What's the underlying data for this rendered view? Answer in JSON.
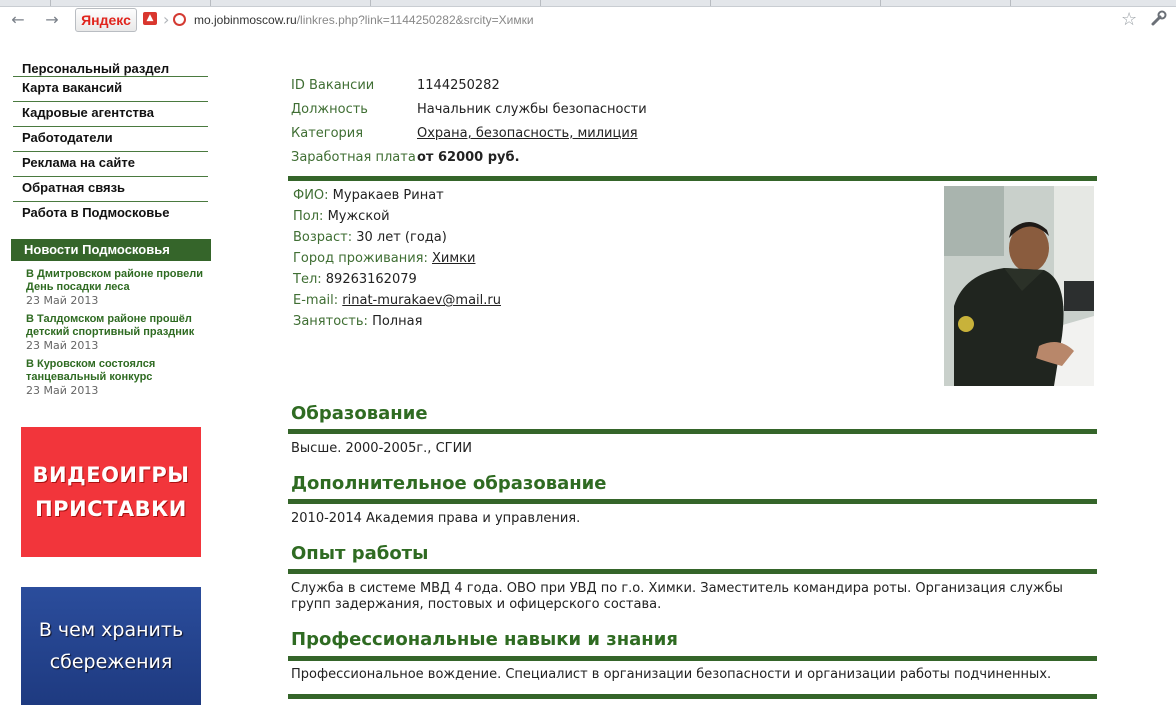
{
  "browser": {
    "search_label": "Яндекс",
    "url_host": "mo.jobinmoscow.ru",
    "url_path": "/linkres.php?link=1144250282&srcity=Химки"
  },
  "nav": {
    "items": [
      "Персональный раздел",
      "Карта вакансий",
      "Кадровые агентства",
      "Работодатели",
      "Реклама на сайте",
      "Обратная связь",
      "Работа в Подмосковье"
    ]
  },
  "news": {
    "heading": "Новости Подмосковья",
    "items": [
      {
        "title": "В Дмитровском районе провели День посадки леса",
        "date": "23 Май 2013"
      },
      {
        "title": "В Талдомском районе прошёл детский спортивный праздник",
        "date": "23 Май 2013"
      },
      {
        "title": "В Куровском состоялся танцевальный конкурс",
        "date": "23 Май 2013"
      }
    ]
  },
  "ads": {
    "ad1_line1": "ВИДЕОИГРЫ",
    "ad1_line2": "ПРИСТАВКИ",
    "ad2_line1": "В чем хранить",
    "ad2_line2": "сбережения"
  },
  "vacancy": {
    "id_label": "ID Вакансии",
    "id_value": "1144250282",
    "position_label": "Должность",
    "position_value": "Начальник службы безопасности",
    "category_label": "Категория",
    "category_value": "Охрана, безопасность, милиция",
    "salary_label": "Заработная плата",
    "salary_value": "от 62000 руб."
  },
  "person": {
    "name_label": "ФИО:",
    "name_value": "Муракаев Ринат",
    "sex_label": "Пол:",
    "sex_value": "Мужской",
    "age_label": "Возраст:",
    "age_value": "30 лет (года)",
    "city_label": "Город проживания:",
    "city_value": "Химки",
    "phone_label": "Тел:",
    "phone_value": "89263162079",
    "email_label": "E-mail:",
    "email_value": "rinat-murakaev@mail.ru",
    "employment_label": "Занятость:",
    "employment_value": "Полная"
  },
  "sections": {
    "education_title": "Образование",
    "education_text": "Высше. 2000-2005г., СГИИ",
    "extra_title": "Дополнительное образование",
    "extra_text": "2010-2014 Академия права и управления.",
    "experience_title": "Опыт работы",
    "experience_text": "Служба в системе МВД 4 года. ОВО при УВД по г.о. Химки. Заместитель командира роты. Организация службы групп задержания, постовых и офицерского состава.",
    "skills_title": "Профессиональные навыки и знания",
    "skills_text": "Профессиональное вождение. Специалист в организации безопасности и организации работы подчиненных."
  },
  "colors": {
    "accent_green": "#35652a",
    "label_green": "#3f6e33",
    "ad_red": "#f2353b",
    "ad_blue": "#2b4d9c"
  }
}
